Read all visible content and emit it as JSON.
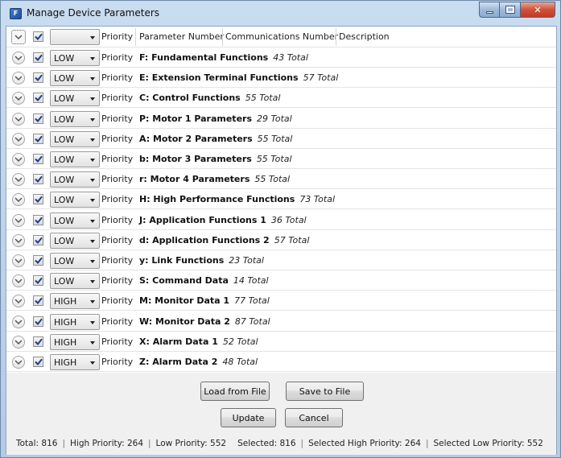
{
  "window": {
    "title": "Manage Device Parameters",
    "icon_text": "F"
  },
  "header": {
    "priority_label": "Priority",
    "columns": [
      "Parameter Number",
      "Communications Number",
      "Description"
    ],
    "combo_value": ""
  },
  "groups": [
    {
      "priority": "LOW",
      "priority_label": "Priority",
      "name": "F: Fundamental Functions",
      "total": "43 Total"
    },
    {
      "priority": "LOW",
      "priority_label": "Priority",
      "name": "E: Extension Terminal Functions",
      "total": "57 Total"
    },
    {
      "priority": "LOW",
      "priority_label": "Priority",
      "name": "C: Control Functions",
      "total": "55 Total"
    },
    {
      "priority": "LOW",
      "priority_label": "Priority",
      "name": "P: Motor 1 Parameters",
      "total": "29 Total"
    },
    {
      "priority": "LOW",
      "priority_label": "Priority",
      "name": "A: Motor 2 Parameters",
      "total": "55 Total"
    },
    {
      "priority": "LOW",
      "priority_label": "Priority",
      "name": "b: Motor 3 Parameters",
      "total": "55 Total"
    },
    {
      "priority": "LOW",
      "priority_label": "Priority",
      "name": "r: Motor 4 Parameters",
      "total": "55 Total"
    },
    {
      "priority": "LOW",
      "priority_label": "Priority",
      "name": "H: High Performance Functions",
      "total": "73 Total"
    },
    {
      "priority": "LOW",
      "priority_label": "Priority",
      "name": "J: Application Functions 1",
      "total": "36 Total"
    },
    {
      "priority": "LOW",
      "priority_label": "Priority",
      "name": "d: Application Functions 2",
      "total": "57 Total"
    },
    {
      "priority": "LOW",
      "priority_label": "Priority",
      "name": "y: Link Functions",
      "total": "23 Total"
    },
    {
      "priority": "LOW",
      "priority_label": "Priority",
      "name": "S: Command Data",
      "total": "14 Total"
    },
    {
      "priority": "HIGH",
      "priority_label": "Priority",
      "name": "M: Monitor Data 1",
      "total": "77 Total"
    },
    {
      "priority": "HIGH",
      "priority_label": "Priority",
      "name": "W: Monitor Data 2",
      "total": "87 Total"
    },
    {
      "priority": "HIGH",
      "priority_label": "Priority",
      "name": "X: Alarm Data 1",
      "total": "52 Total"
    },
    {
      "priority": "HIGH",
      "priority_label": "Priority",
      "name": "Z: Alarm Data 2",
      "total": "48 Total"
    }
  ],
  "buttons": {
    "load": "Load from File",
    "save": "Save to File",
    "update": "Update",
    "cancel": "Cancel"
  },
  "status": {
    "total": "Total: 816",
    "high": "High Priority: 264",
    "low": "Low Priority: 552",
    "selected": "Selected: 816",
    "selected_high": "Selected High Priority: 264",
    "selected_low": "Selected Low Priority: 552"
  },
  "icons": {
    "expand": "chevron-down-icon",
    "checked": "checkmark-icon",
    "minimize": "minimize-icon",
    "maximize": "maximize-icon",
    "close": "close-icon"
  },
  "colors": {
    "title_bar": "#c3d7ee",
    "close_button": "#c94a33",
    "check": "#1c3f8a"
  }
}
